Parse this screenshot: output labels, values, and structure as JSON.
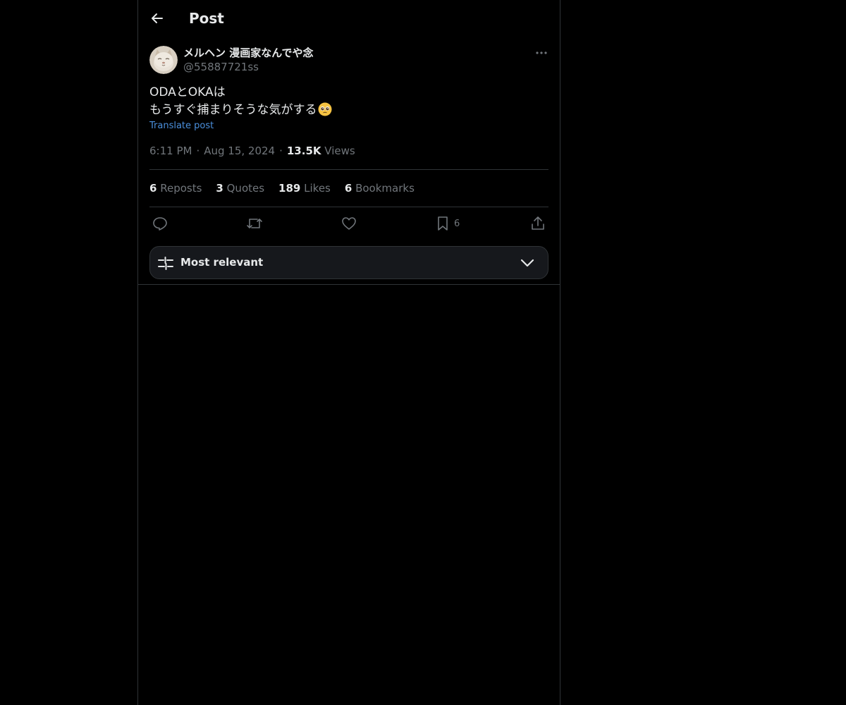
{
  "header": {
    "title": "Post",
    "back_icon": "arrow-left-icon"
  },
  "post": {
    "author": {
      "name": "メルヘン 漫画家なんでや念",
      "handle": "@55887721ss",
      "avatar_icon": "cat-avatar"
    },
    "text_line1": "ODAとOKAは",
    "text_line2": "もうすぐ捕まりそうな気がする",
    "text_emoji": "pleading-face-emoji",
    "translate_label": "Translate post",
    "time": "6:11 PM",
    "date": "Aug 15, 2024",
    "views_count": "13.5K",
    "views_label": "Views",
    "separator": "·"
  },
  "stats": {
    "reposts_count": "6",
    "reposts_label": "Reposts",
    "quotes_count": "3",
    "quotes_label": "Quotes",
    "likes_count": "189",
    "likes_label": "Likes",
    "bookmarks_count": "6",
    "bookmarks_label": "Bookmarks"
  },
  "actions": {
    "reply_icon": "reply-icon",
    "repost_icon": "repost-icon",
    "like_icon": "heart-icon",
    "bookmark_icon": "bookmark-icon",
    "bookmark_count": "6",
    "share_icon": "share-icon"
  },
  "sort": {
    "label": "Most relevant",
    "icon": "sliders-icon",
    "chevron": "chevron-down-icon"
  },
  "colors": {
    "background": "#000000",
    "text": "#e7e9ea",
    "secondary_text": "#71767b",
    "link": "#4a8fdc",
    "border": "#2f3336"
  }
}
